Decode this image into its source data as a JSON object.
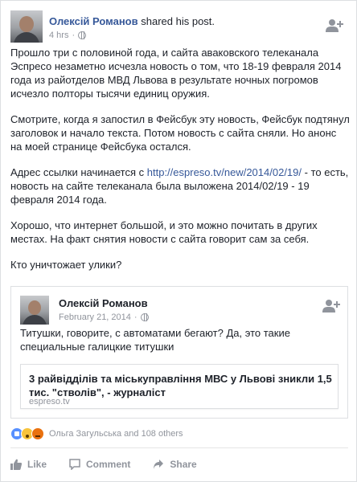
{
  "post": {
    "author": "Олексій Романов",
    "action": "shared his post.",
    "time": "4 hrs",
    "separator": "·",
    "paragraphs": [
      "Прошло три с половиной года, и сайта аваковского телеканала Эспресо незаметно исчезла новость о том, что 18-19 февраля 2014 года из райотделов МВД Львова в результате ночных погромов исчезло полторы тысячи единиц оружия.",
      "Смотрите, когда я запостил в Фейсбук эту новость, Фейсбук подтянул заголовок и начало текста. Потом новость с сайта сняли.   Но анонс на моей странице Фейсбука остался.",
      "Хорошо, что интернет большой, и это можно почитать в других местах. На факт снятия новости с сайта говорит сам за себя.",
      "Кто уничтожает улики?"
    ],
    "link_paragraph": {
      "before": "Адрес ссылки начинается с ",
      "url": "http://espreso.tv/new/2014/02/19/",
      "after": " - то есть, новость на сайте телеканала была выложена  2014/02/19 - 19 февраля 2014 года."
    }
  },
  "shared": {
    "author": "Олексій Романов",
    "date": "February 21, 2014",
    "separator": "·",
    "text": "Титушки, говорите, с автоматами бегают? Да, это такие специальные галицкие титушки",
    "link_title": "3 райвідділів та міськуправління МВС у Львові зникли 1,5 тис. \"стволів\", - журналіст",
    "link_domain": "espreso.tv"
  },
  "reactions": {
    "summary": "Ольга Загульська and 108 others",
    "icons": [
      "like-icon",
      "wow-icon",
      "angry-icon"
    ]
  },
  "actions": {
    "like": "Like",
    "comment": "Comment",
    "share": "Share"
  },
  "colors": {
    "link": "#365899",
    "muted": "#90949c",
    "text": "#1d2129"
  }
}
